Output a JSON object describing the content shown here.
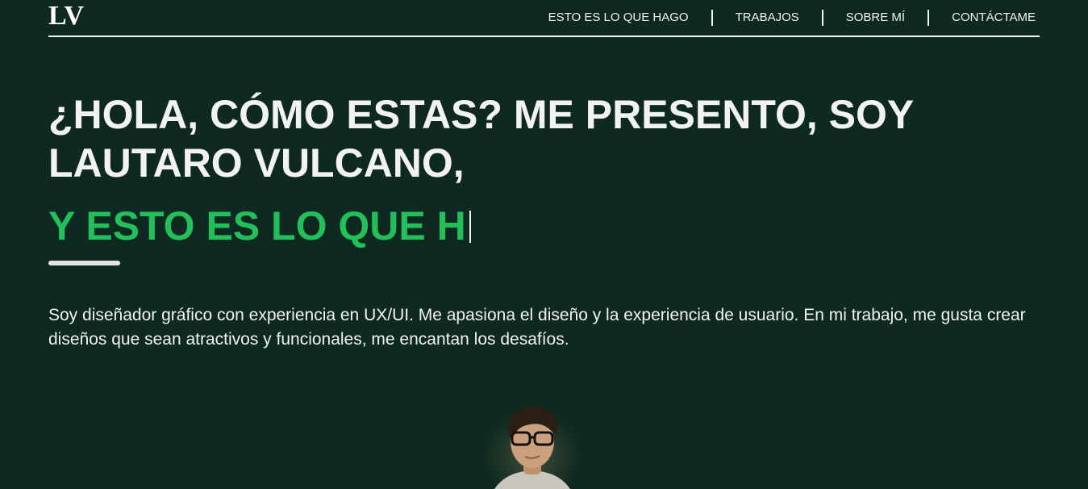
{
  "header": {
    "logo": "LV",
    "nav": [
      {
        "label": "ESTO ES LO QUE HAGO"
      },
      {
        "label": "TRABAJOS"
      },
      {
        "label": "SOBRE MÍ"
      },
      {
        "label": "CONTÁCTAME"
      }
    ]
  },
  "hero": {
    "title": "¿HOLA, CÓMO ESTAS? ME PRESENTO, SOY LAUTARO VULCANO,",
    "typed": "Y ESTO ES LO QUE H",
    "bio": "Soy diseñador gráfico con experiencia en UX/UI. Me apasiona el diseño y la experiencia de usuario. En mi trabajo, me gusta crear diseños que sean atractivos y funcionales, me encantan los desafíos."
  },
  "colors": {
    "background": "#0e2921",
    "accent": "#22bf5a",
    "text": "#f2f2f2"
  }
}
